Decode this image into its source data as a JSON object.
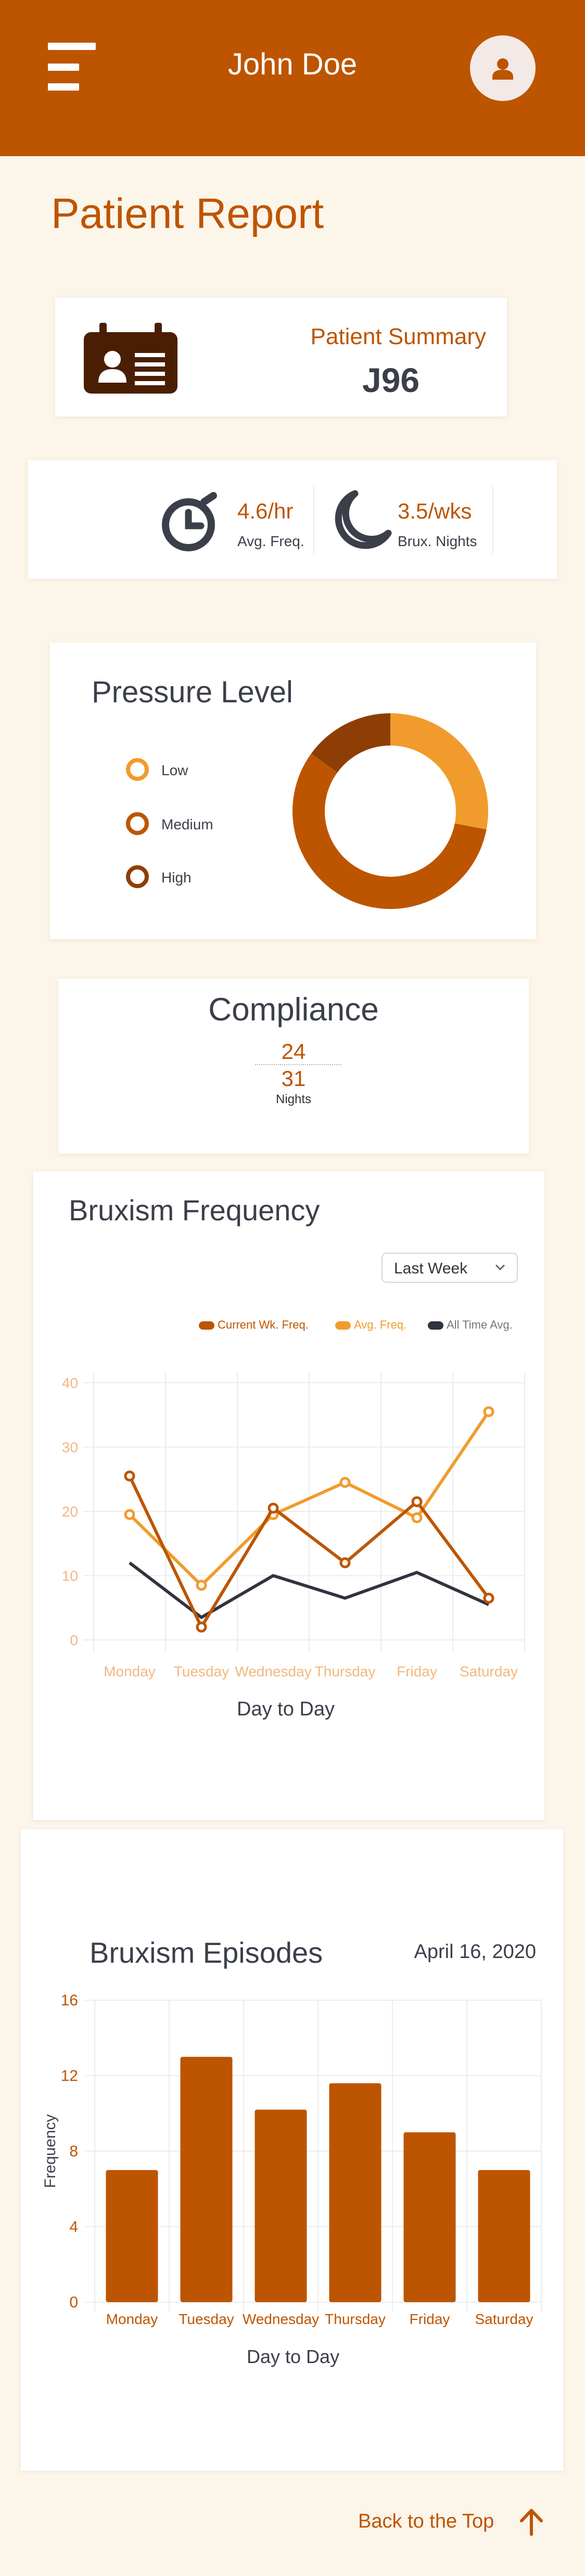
{
  "header": {
    "user_name": "John Doe",
    "menu_icon": "hamburger-icon",
    "avatar_icon": "user-icon"
  },
  "page_title": "Patient Report",
  "summary": {
    "icon": "id-badge-icon",
    "label": "Patient Summary",
    "value": "J96"
  },
  "stats": [
    {
      "icon": "stopwatch-icon",
      "value": "4.6/hr",
      "label": "Avg. Freq."
    },
    {
      "icon": "moon-icon",
      "value": "3.5/wks",
      "label": "Brux. Nights"
    }
  ],
  "pressure": {
    "title": "Pressure Level",
    "legend": [
      {
        "label": "Low",
        "color": "#f19b2c"
      },
      {
        "label": "Medium",
        "color": "#bd5500"
      },
      {
        "label": "High",
        "color": "#8e3e04"
      }
    ]
  },
  "compliance": {
    "title": "Compliance",
    "numerator": "24",
    "denominator": "31",
    "unit": "Nights"
  },
  "frequency": {
    "title": "Bruxism Frequency",
    "range_select": "Last Week",
    "xlabel": "Day to Day"
  },
  "episodes": {
    "title": "Bruxism Episodes",
    "date": "April 16, 2020",
    "xlabel": "Day to Day",
    "ylabel": "Frequency"
  },
  "footer": {
    "back_to_top": "Back to the Top",
    "icon": "arrow-up-icon"
  },
  "colors": {
    "brand": "#bd5500",
    "light_orange": "#f19b2c",
    "dark": "#3b3f4a",
    "background": "#fcf5ea"
  },
  "chart_data": [
    {
      "type": "pie",
      "title": "Pressure Level",
      "donut": true,
      "categories": [
        "Low",
        "Medium",
        "High"
      ],
      "values": [
        28,
        57,
        15
      ],
      "colors": [
        "#f19b2c",
        "#bd5500",
        "#8e3e04"
      ]
    },
    {
      "type": "line",
      "title": "Bruxism Frequency",
      "xlabel": "Day to Day",
      "categories": [
        "Monday",
        "Tuesday",
        "Wednesday",
        "Thursday",
        "Friday",
        "Saturday"
      ],
      "yticks": [
        "0",
        "10",
        "20",
        "30",
        "40"
      ],
      "ylim": [
        0,
        40
      ],
      "legend_position": "top-right",
      "grid": true,
      "series": [
        {
          "name": "Current Wk. Freq.",
          "color": "#bd5500",
          "values": [
            25.5,
            2,
            20.5,
            12,
            21.5,
            6.5
          ]
        },
        {
          "name": "Avg. Freq.",
          "color": "#f19b2c",
          "values": [
            19.5,
            8.5,
            19.5,
            24.5,
            19,
            35.5
          ]
        },
        {
          "name": "All Time Avg.",
          "color": "#2f343f",
          "values": [
            12,
            3.5,
            10,
            6.5,
            10.5,
            5.5
          ]
        }
      ]
    },
    {
      "type": "bar",
      "title": "Bruxism Episodes",
      "xlabel": "Day to Day",
      "ylabel": "Frequency",
      "categories": [
        "Monday",
        "Tuesday",
        "Wednesday",
        "Thursday",
        "Friday",
        "Saturday"
      ],
      "values": [
        7,
        13,
        10.2,
        11.6,
        9,
        7
      ],
      "yticks": [
        "0",
        "4",
        "8",
        "12",
        "16"
      ],
      "ylim": [
        0,
        16
      ],
      "grid": true,
      "color": "#bd5500"
    }
  ]
}
